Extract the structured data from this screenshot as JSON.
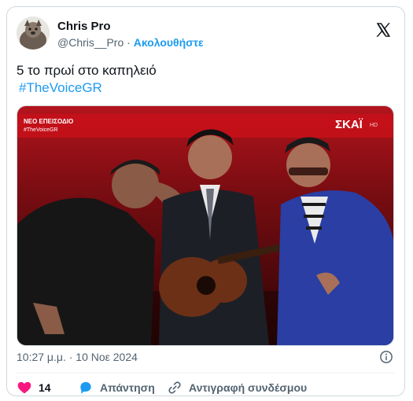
{
  "author": {
    "name": "Chris Pro",
    "handle": "@Chris__Pro",
    "separator": "·",
    "follow_label": "Ακολουθήστε"
  },
  "tweet": {
    "text": "5 το πρωί στο καπηλειό",
    "hashtag": "#TheVoiceGR"
  },
  "media": {
    "badge_text": "ΝΕΟ ΕΠΕΙΣΟΔΙΟ",
    "badge_subtext": "#TheVoiceGR",
    "channel_logo": "ΣΚΑΪ",
    "channel_suffix": "HD"
  },
  "timestamp": "10:27 μ.μ. · 10 Νοε 2024",
  "actions": {
    "likes": "14",
    "reply_label": "Απάντηση",
    "copy_link_label": "Αντιγραφή συνδέσμου"
  },
  "colors": {
    "accent": "#1d9bf0",
    "like": "#f91880",
    "text_primary": "#0f1419",
    "text_secondary": "#536471"
  },
  "icons": [
    "x-logo-icon",
    "info-icon",
    "heart-icon",
    "reply-bubble-icon",
    "link-icon"
  ]
}
